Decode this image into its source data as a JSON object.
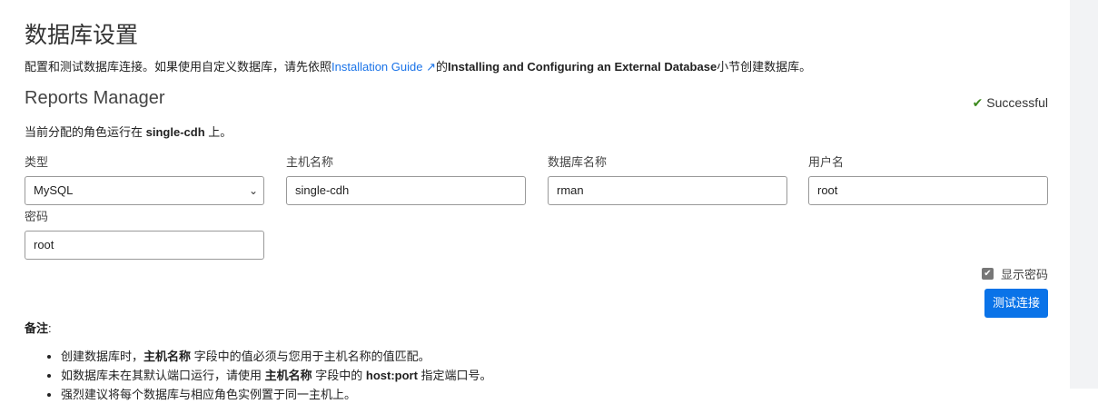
{
  "title": "数据库设置",
  "intro": {
    "pre": "配置和测试数据库连接。如果使用自定义数据库，请先依照",
    "link": "Installation Guide",
    "mid": "的",
    "bold": "Installing and Configuring an External Database",
    "post": "小节创建数据库。"
  },
  "section": {
    "title": "Reports Manager",
    "status": "Successful",
    "role_pre": "当前分配的角色运行在 ",
    "role_host": "single-cdh",
    "role_post": " 上。"
  },
  "fields": {
    "type": {
      "label": "类型",
      "value": "MySQL"
    },
    "host": {
      "label": "主机名称",
      "value": "single-cdh"
    },
    "db": {
      "label": "数据库名称",
      "value": "rman"
    },
    "user": {
      "label": "用户名",
      "value": "root"
    },
    "password": {
      "label": "密码",
      "value": "root"
    }
  },
  "show_password": "显示密码",
  "test_button": "测试连接",
  "notes": {
    "title": "备注",
    "items": [
      {
        "a": "创建数据库时，",
        "b": "主机名称",
        "c": " 字段中的值必须与您用于主机名称的值匹配。"
      },
      {
        "a": "如数据库未在其默认端口运行，请使用 ",
        "b": "主机名称",
        "c": " 字段中的 ",
        "d": "host:port",
        "e": " 指定端口号。"
      },
      {
        "a": "强烈建议将每个数据库与相应角色实例置于同一主机上。"
      }
    ]
  }
}
